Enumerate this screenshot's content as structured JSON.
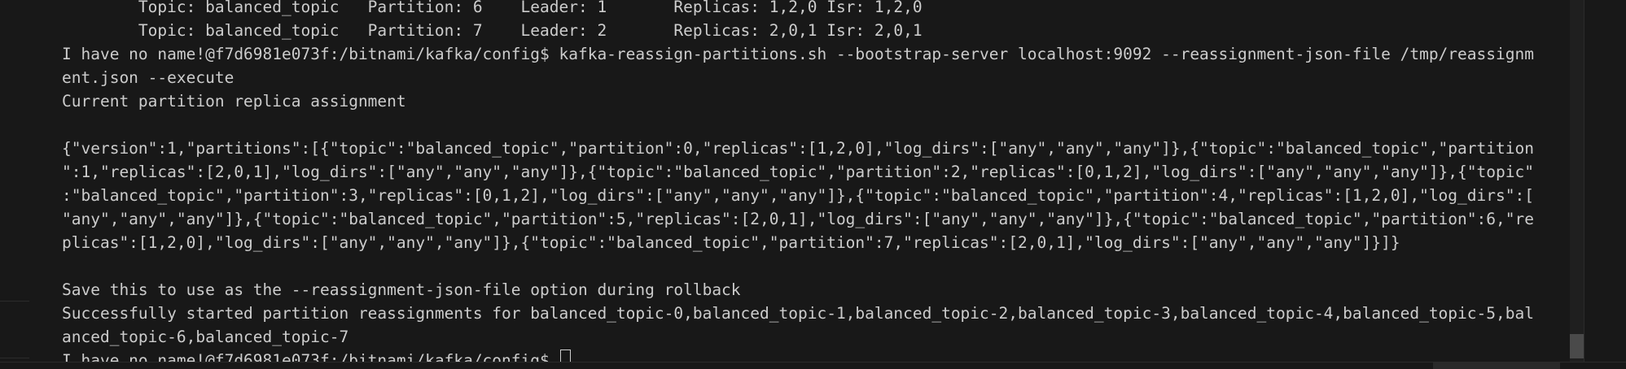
{
  "terminal": {
    "lines": [
      "        Topic: balanced_topic   Partition: 6    Leader: 1       Replicas: 1,2,0 Isr: 1,2,0",
      "        Topic: balanced_topic   Partition: 7    Leader: 2       Replicas: 2,0,1 Isr: 2,0,1",
      "I have no name!@f7d6981e073f:/bitnami/kafka/config$ kafka-reassign-partitions.sh --bootstrap-server localhost:9092 --reassignment-json-file /tmp/reassignm",
      "ent.json --execute",
      "Current partition replica assignment",
      "",
      "{\"version\":1,\"partitions\":[{\"topic\":\"balanced_topic\",\"partition\":0,\"replicas\":[1,2,0],\"log_dirs\":[\"any\",\"any\",\"any\"]},{\"topic\":\"balanced_topic\",\"partition",
      "\":1,\"replicas\":[2,0,1],\"log_dirs\":[\"any\",\"any\",\"any\"]},{\"topic\":\"balanced_topic\",\"partition\":2,\"replicas\":[0,1,2],\"log_dirs\":[\"any\",\"any\",\"any\"]},{\"topic\"",
      ":\"balanced_topic\",\"partition\":3,\"replicas\":[0,1,2],\"log_dirs\":[\"any\",\"any\",\"any\"]},{\"topic\":\"balanced_topic\",\"partition\":4,\"replicas\":[1,2,0],\"log_dirs\":[",
      "\"any\",\"any\",\"any\"]},{\"topic\":\"balanced_topic\",\"partition\":5,\"replicas\":[2,0,1],\"log_dirs\":[\"any\",\"any\",\"any\"]},{\"topic\":\"balanced_topic\",\"partition\":6,\"re",
      "plicas\":[1,2,0],\"log_dirs\":[\"any\",\"any\",\"any\"]},{\"topic\":\"balanced_topic\",\"partition\":7,\"replicas\":[2,0,1],\"log_dirs\":[\"any\",\"any\",\"any\"]}]}",
      "",
      "Save this to use as the --reassignment-json-file option during rollback",
      "Successfully started partition reassignments for balanced_topic-0,balanced_topic-1,balanced_topic-2,balanced_topic-3,balanced_topic-4,balanced_topic-5,bal",
      "anced_topic-6,balanced_topic-7"
    ],
    "prompt": "I have no name!@f7d6981e073f:/bitnami/kafka/config$ "
  }
}
